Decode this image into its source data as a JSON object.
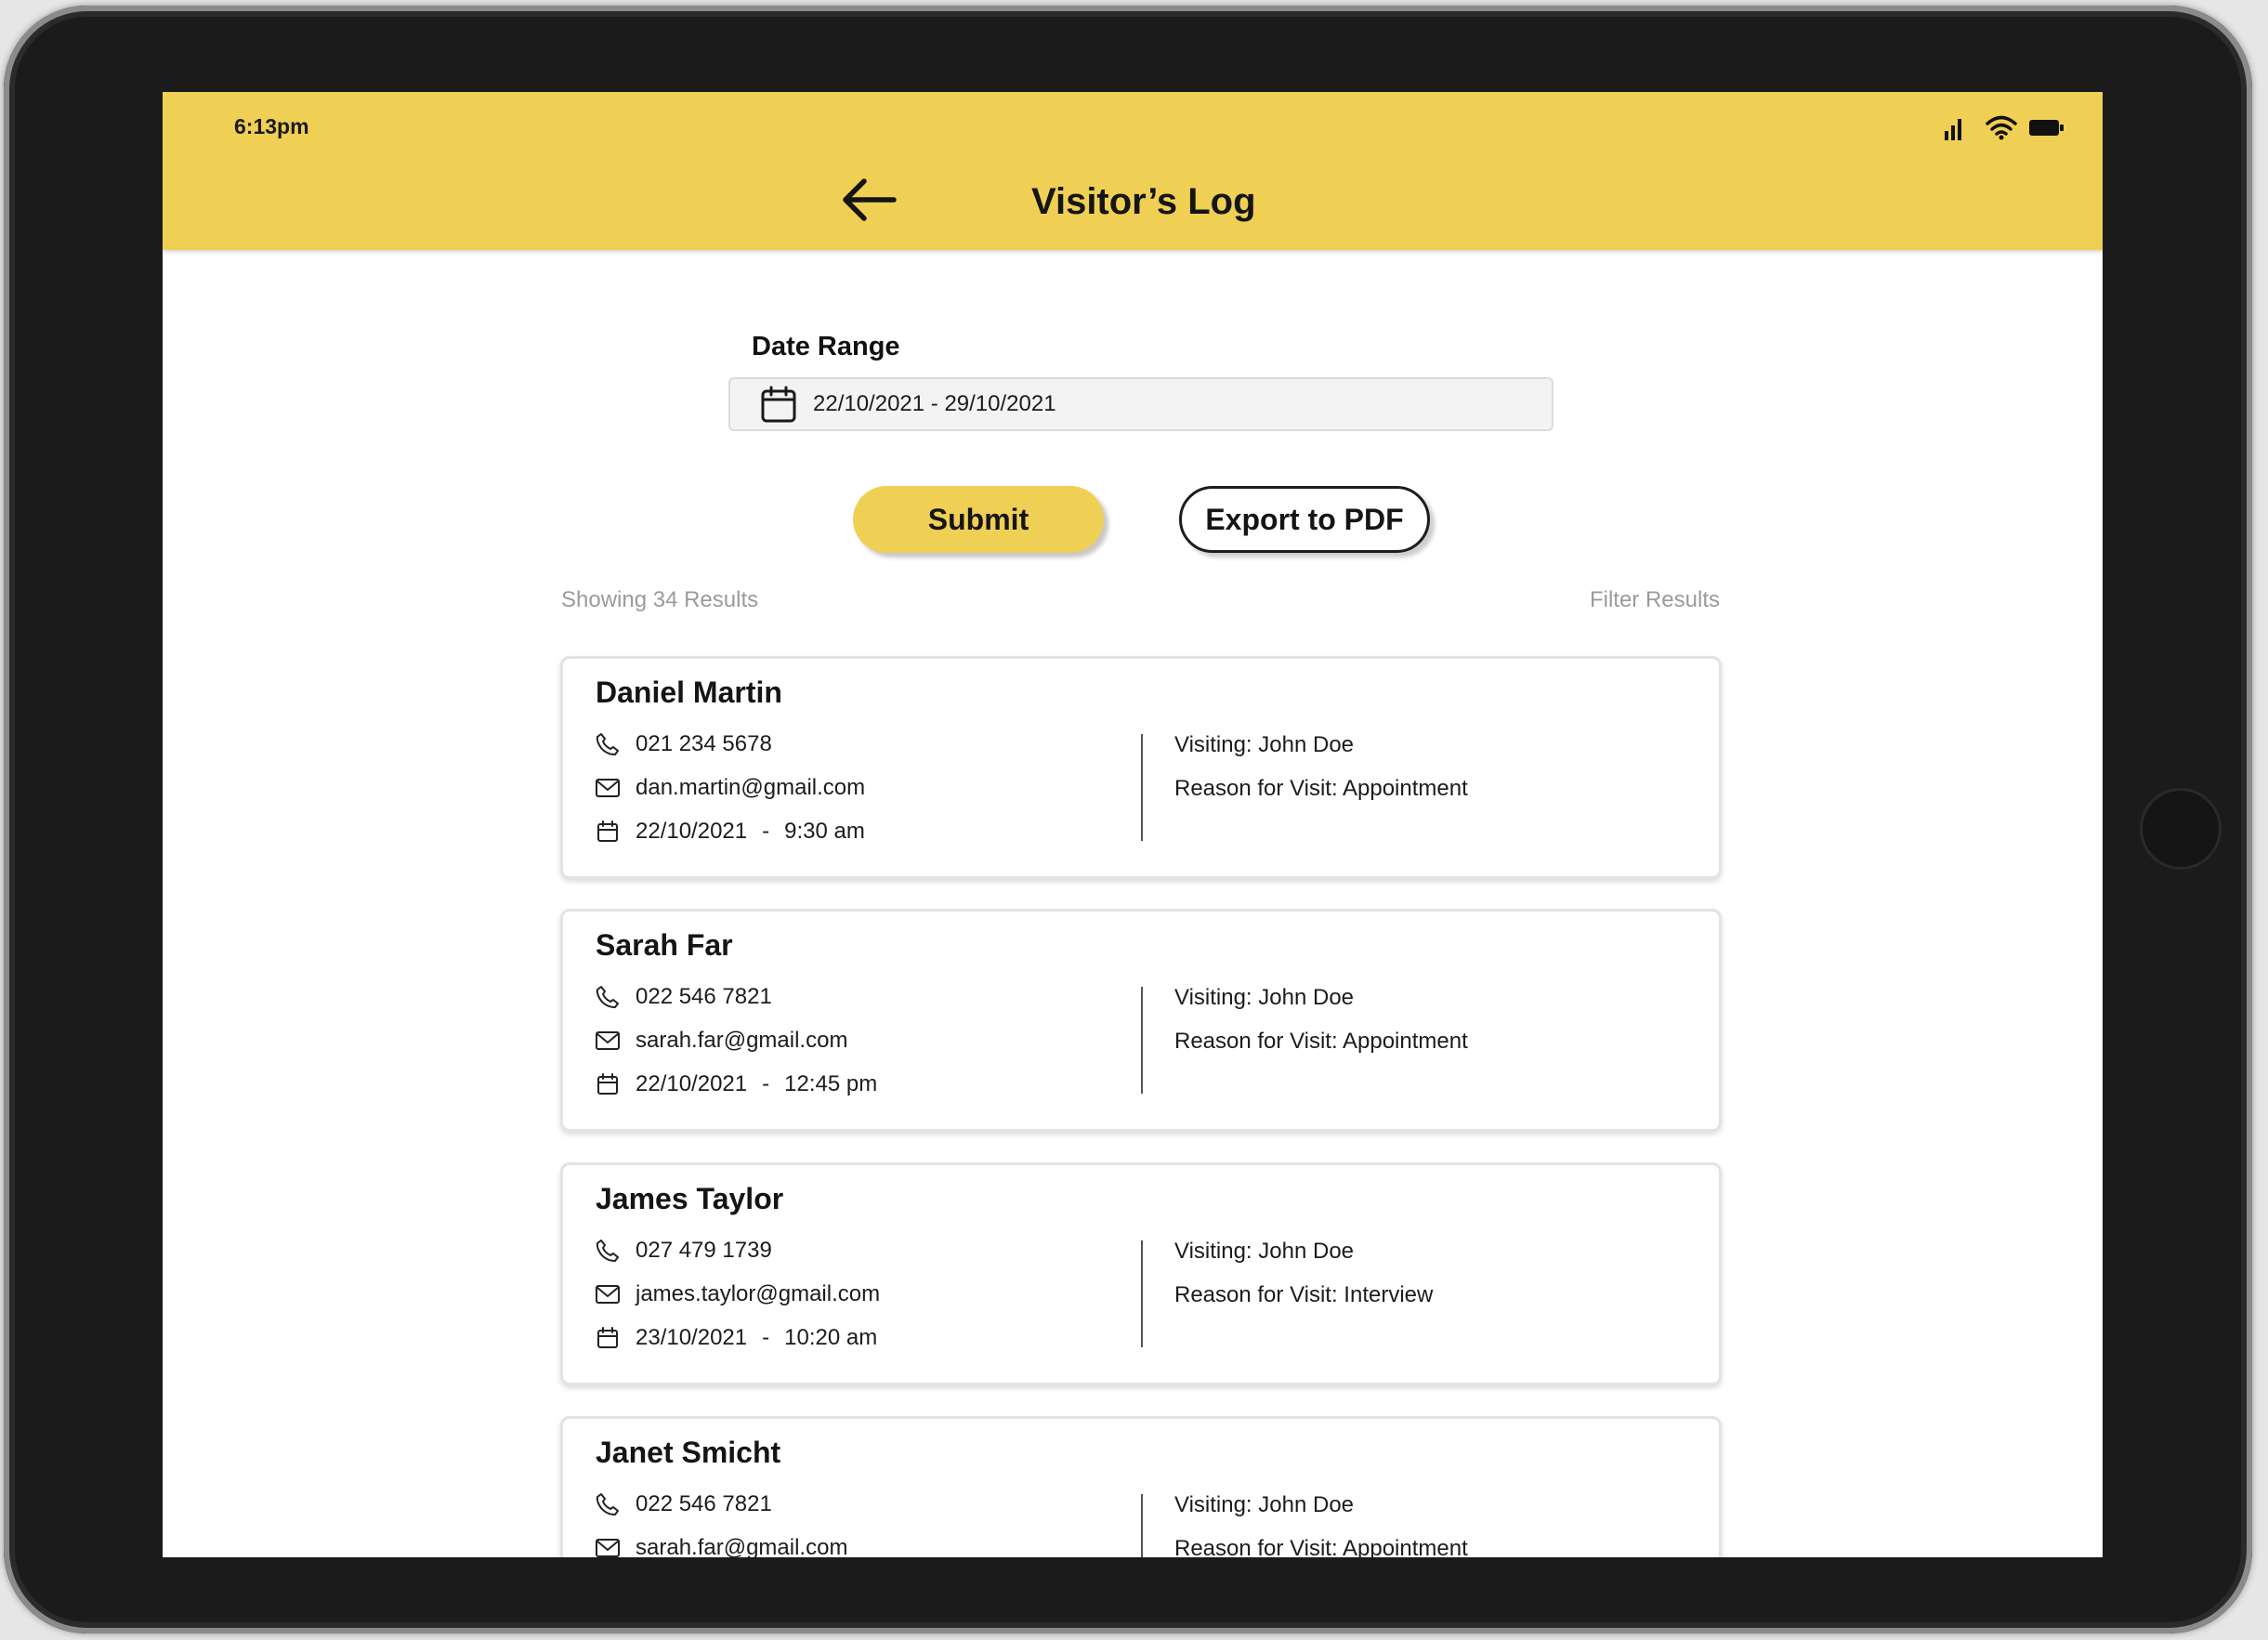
{
  "status_bar": {
    "time": "6:13pm"
  },
  "header": {
    "title": "Visitor’s Log"
  },
  "date_range": {
    "label": "Date Range",
    "value": "22/10/2021 - 29/10/2021"
  },
  "actions": {
    "submit": "Submit",
    "export": "Export to PDF"
  },
  "results": {
    "count_text": "Showing 34 Results",
    "filter_label": "Filter Results"
  },
  "visitors": [
    {
      "name": "Daniel Martin",
      "phone": "021 234 5678",
      "email": "dan.martin@gmail.com",
      "date": "22/10/2021",
      "sep": "-",
      "time": "9:30 am",
      "visiting": "Visiting: John Doe",
      "reason": "Reason for Visit: Appointment"
    },
    {
      "name": "Sarah Far",
      "phone": "022 546 7821",
      "email": "sarah.far@gmail.com",
      "date": "22/10/2021",
      "sep": "-",
      "time": "12:45 pm",
      "visiting": "Visiting: John Doe",
      "reason": "Reason for Visit: Appointment"
    },
    {
      "name": "James Taylor",
      "phone": "027 479 1739",
      "email": "james.taylor@gmail.com",
      "date": "23/10/2021",
      "sep": "-",
      "time": "10:20 am",
      "visiting": "Visiting: John Doe",
      "reason": "Reason for Visit: Interview"
    },
    {
      "name": "Janet Smicht",
      "phone": "022 546 7821",
      "email": "sarah.far@gmail.com",
      "date": "",
      "sep": "",
      "time": "",
      "visiting": "Visiting: John Doe",
      "reason": "Reason for Visit: Appointment"
    }
  ],
  "icons": {
    "back": "arrow-left-icon",
    "calendar": "calendar-icon",
    "phone": "phone-icon",
    "email": "mail-icon",
    "signal": "signal-icon",
    "wifi": "wifi-icon",
    "battery": "battery-icon"
  },
  "colors": {
    "accent": "#f0cf55",
    "muted_text": "#9b9b9b"
  }
}
